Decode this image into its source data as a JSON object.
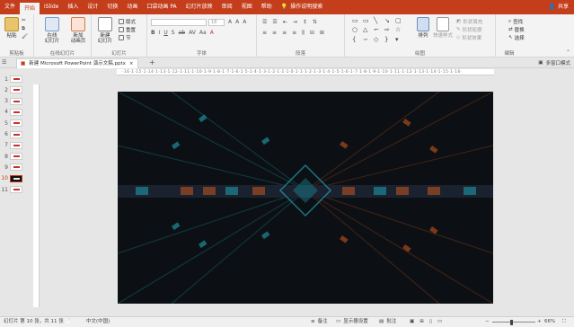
{
  "tabs": [
    "文件",
    "开始",
    "iSlide",
    "插入",
    "设计",
    "切换",
    "动画",
    "口袋动画 PA",
    "幻灯片放映",
    "审阅",
    "视图",
    "帮助"
  ],
  "active_tab": "开始",
  "search_label": "操作说明搜索",
  "share_label": "共享",
  "ribbon": {
    "clipboard": {
      "paste": "粘贴",
      "label": "剪贴板"
    },
    "online": {
      "btn1_line1": "在线",
      "btn1_line2": "幻灯片",
      "btn2_line1": "新加",
      "btn2_line2": "动画页",
      "label": "在线幻灯片"
    },
    "slides": {
      "new_line1": "新建",
      "new_line2": "幻灯片",
      "layout": "版式",
      "reset": "重置",
      "section": "节",
      "label": "幻灯片"
    },
    "font": {
      "label": "字体",
      "size": "18"
    },
    "paragraph": {
      "label": "段落"
    },
    "drawing": {
      "arrange": "排列",
      "quick_styles": "快速样式",
      "fill": "形状填充",
      "outline": "形状轮廓",
      "effects": "形状效果",
      "label": "绘图"
    },
    "editing": {
      "find": "查找",
      "replace": "替换",
      "select": "选择",
      "label": "编辑"
    }
  },
  "doc_tab": "新建 Microsoft PowerPoint 演示文稿.pptx",
  "view_mode": "多窗口模式",
  "ruler_text": "·16·1·15·1·14·1·13·1·12·1·11·1·10·1·9·1·8·1·7·1·6·1·5·1·4·1·3·1·2·1·1·1·0·1·1·1·2·1·3·1·4·1·5·1·6·1·7·1·8·1·9·1·10·1·11·1·12·1·13·1·14·1·15·1·16·",
  "slides": [
    {
      "num": "1"
    },
    {
      "num": "2"
    },
    {
      "num": "3"
    },
    {
      "num": "4"
    },
    {
      "num": "5"
    },
    {
      "num": "6"
    },
    {
      "num": "7"
    },
    {
      "num": "8"
    },
    {
      "num": "9"
    },
    {
      "num": "10"
    },
    {
      "num": "11"
    }
  ],
  "active_slide": "10",
  "status": {
    "slide_info": "幻灯片 第 10 张，共 11 张",
    "language": "中文(中国)",
    "notes": "备注",
    "display": "显示器设置",
    "comments": "批注",
    "zoom": "66%"
  },
  "colors": {
    "accent": "#c43e1c",
    "slide_bg": "#0c1014",
    "cyan": "#1fa3b3",
    "orange": "#c8551c"
  }
}
